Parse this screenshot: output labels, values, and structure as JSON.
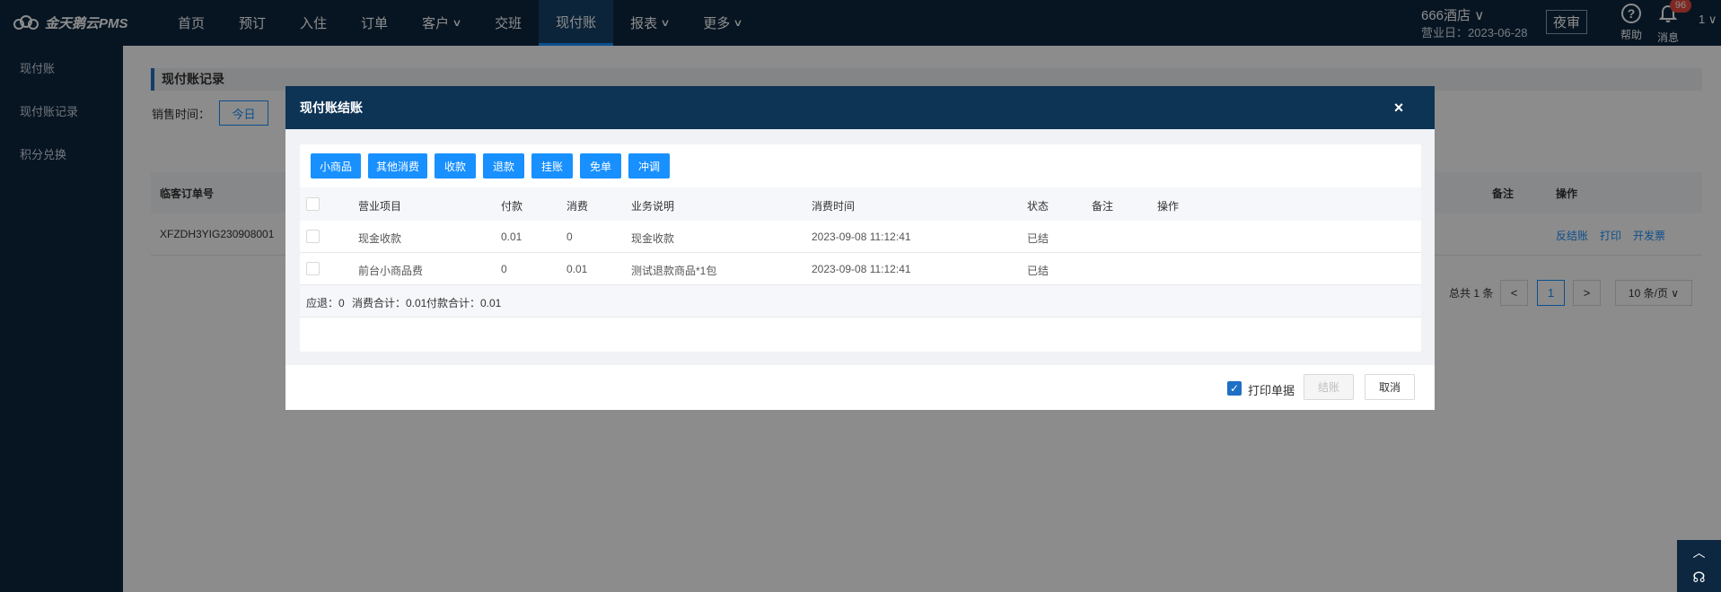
{
  "brand": {
    "name": "金天鹅云PMS"
  },
  "nav": [
    {
      "label": "首页",
      "chevron": ""
    },
    {
      "label": "预订",
      "chevron": ""
    },
    {
      "label": "入住",
      "chevron": ""
    },
    {
      "label": "订单",
      "chevron": ""
    },
    {
      "label": "客户",
      "chevron": "∨"
    },
    {
      "label": "交班",
      "chevron": ""
    },
    {
      "label": "现付账",
      "chevron": ""
    },
    {
      "label": "报表",
      "chevron": "∨"
    },
    {
      "label": "更多",
      "chevron": "∨"
    }
  ],
  "header": {
    "hotel": "666酒店 ∨",
    "biz_date": "营业日：2023-06-28",
    "night_audit": "夜审",
    "help": "帮助",
    "messages": "消息",
    "message_count": "96",
    "user": "1 ∨"
  },
  "sidebar": [
    {
      "label": "现付账"
    },
    {
      "label": "现付账记录"
    },
    {
      "label": "积分兑换"
    }
  ],
  "page": {
    "title": "现付账记录",
    "filter_label": "销售时间：",
    "filter_today": "今日",
    "columns": {
      "order_no": "临客订单号",
      "remark": "备注",
      "ops": "操作"
    },
    "row": {
      "order_no": "XFZDH3YIG230908001",
      "actions": [
        "反结账",
        "打印",
        "开发票"
      ]
    },
    "pager": {
      "total": "总共 1 条",
      "prev": "<",
      "current": "1",
      "next": ">",
      "page_size": "10 条/页 ∨"
    }
  },
  "modal": {
    "title": "现付账结账",
    "close": "×",
    "toolbar": [
      "小商品",
      "其他消费",
      "收款",
      "退款",
      "挂账",
      "免单",
      "冲调"
    ],
    "columns": [
      "营业项目",
      "付款",
      "消费",
      "业务说明",
      "消费时间",
      "状态",
      "备注",
      "操作"
    ],
    "rows": [
      {
        "item": "现金收款",
        "pay": "0.01",
        "consume": "0",
        "desc": "现金收款",
        "time": "2023-09-08 11:12:41",
        "status": "已结",
        "remark": "",
        "op": ""
      },
      {
        "item": "前台小商品费",
        "pay": "0",
        "consume": "0.01",
        "desc": "测试退款商品*1包",
        "time": "2023-09-08 11:12:41",
        "status": "已结",
        "remark": "",
        "op": ""
      }
    ],
    "summary": {
      "refund_due": "应退：0",
      "consume_total": "消费合计：0.01",
      "pay_total": "付款合计：0.01"
    },
    "footer": {
      "print_receipt": "打印单据",
      "settle": "结账",
      "cancel": "取消"
    }
  },
  "float": {
    "up": "︿",
    "service": "☊"
  },
  "colors": {
    "nav_bg": "#0d2740",
    "primary": "#1890ff",
    "modal_head": "#0d3355"
  }
}
